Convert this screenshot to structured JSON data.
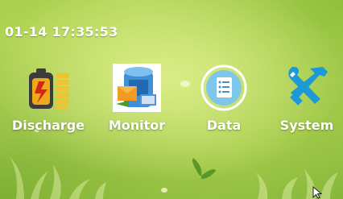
{
  "status": {
    "datetime": "01-14 17:35:53"
  },
  "apps": [
    {
      "label": "Discharge",
      "icon": "battery-icon"
    },
    {
      "label": "Monitor",
      "icon": "monitor-icon"
    },
    {
      "label": "Data",
      "icon": "document-list-icon"
    },
    {
      "label": "System",
      "icon": "tools-icon"
    }
  ],
  "colors": {
    "background": "#b5d858",
    "label_text": "#ffffff",
    "battery_fill": "#f0a81a",
    "tools_blue": "#1a9ad6"
  }
}
